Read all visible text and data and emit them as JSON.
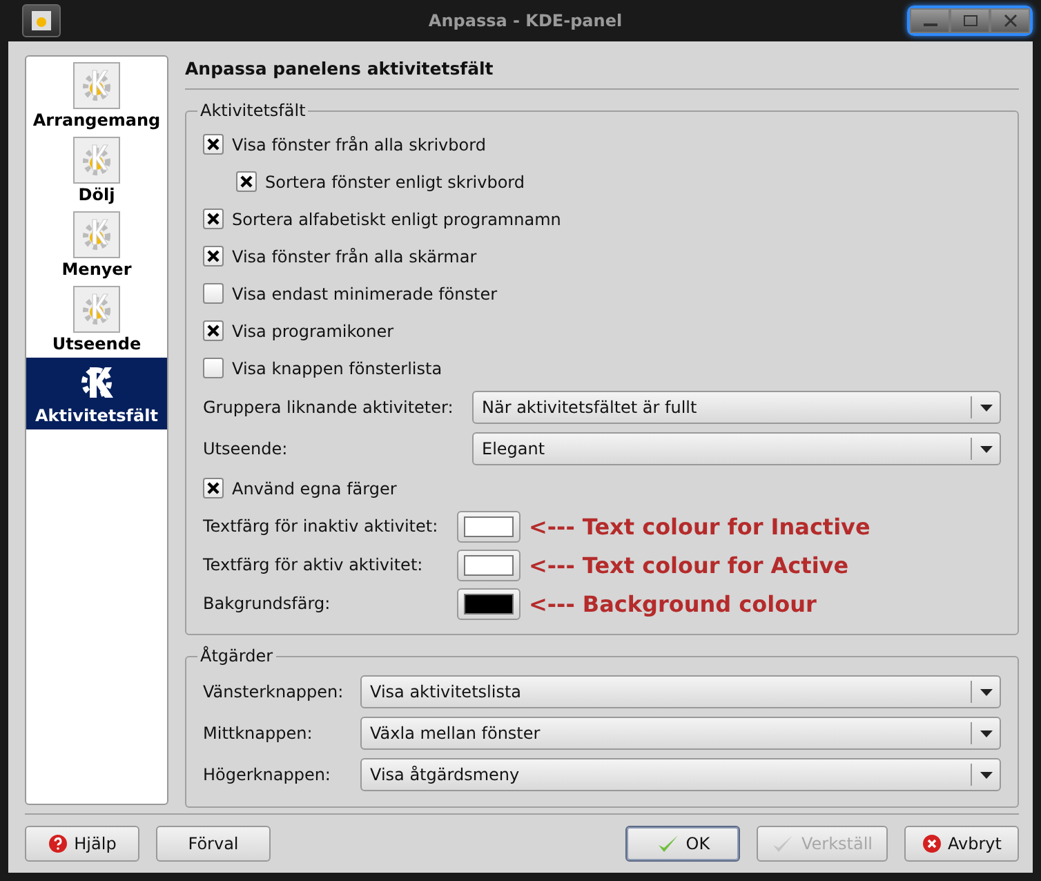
{
  "window": {
    "title": "Anpassa - KDE-panel"
  },
  "sidebar": {
    "items": [
      {
        "label": "Arrangemang",
        "selected": false
      },
      {
        "label": "Dölj",
        "selected": false
      },
      {
        "label": "Menyer",
        "selected": false
      },
      {
        "label": "Utseende",
        "selected": false
      },
      {
        "label": "Aktivitetsfält",
        "selected": true
      }
    ]
  },
  "page_title": "Anpassa panelens aktivitetsfält",
  "taskbar_group": {
    "title": "Aktivitetsfält",
    "checkboxes": [
      {
        "label": "Visa fönster från alla skrivbord",
        "checked": true,
        "children": [
          {
            "label": "Sortera fönster enligt skrivbord",
            "checked": true
          }
        ]
      },
      {
        "label": "Sortera alfabetiskt enligt programnamn",
        "checked": true
      },
      {
        "label": "Visa fönster från alla skärmar",
        "checked": true
      },
      {
        "label": "Visa endast minimerade fönster",
        "checked": false
      },
      {
        "label": "Visa programikoner",
        "checked": true
      },
      {
        "label": "Visa knappen fönsterlista",
        "checked": false
      }
    ],
    "dropdowns": [
      {
        "label": "Gruppera liknande aktiviteter:",
        "value": "När aktivitetsfältet är fullt"
      },
      {
        "label": "Utseende:",
        "value": "Elegant"
      }
    ],
    "custom_colors": {
      "label": "Använd egna färger",
      "checked": true
    },
    "colors": [
      {
        "label": "Textfärg för inaktiv aktivitet:",
        "color": "#ffffff",
        "annotation": "<--- Text colour for Inactive"
      },
      {
        "label": "Textfärg för aktiv aktivitet:",
        "color": "#ffffff",
        "annotation": "<--- Text colour for Active"
      },
      {
        "label": "Bakgrundsfärg:",
        "color": "#000000",
        "annotation": "<--- Background colour"
      }
    ]
  },
  "actions_group": {
    "title": "Åtgärder",
    "dropdowns": [
      {
        "label": "Vänsterknappen:",
        "value": "Visa aktivitetslista"
      },
      {
        "label": "Mittknappen:",
        "value": "Växla mellan fönster"
      },
      {
        "label": "Högerknappen:",
        "value": "Visa åtgärdsmeny"
      }
    ]
  },
  "buttons_left": [
    {
      "label": "Hjälp",
      "kind": "help"
    },
    {
      "label": "Förval",
      "kind": "plain"
    }
  ],
  "buttons_right": [
    {
      "label": "OK",
      "kind": "ok",
      "default": true,
      "disabled": false
    },
    {
      "label": "Verkställ",
      "kind": "ok",
      "default": false,
      "disabled": true
    },
    {
      "label": "Avbryt",
      "kind": "cancel",
      "default": false,
      "disabled": false
    }
  ]
}
